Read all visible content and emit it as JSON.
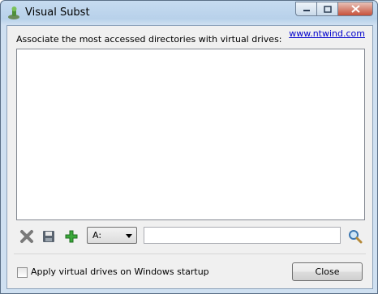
{
  "window": {
    "title": "Visual Subst",
    "app_icon": "visual-subst-app-icon",
    "controls": {
      "minimize_icon": "minimize-icon",
      "maximize_icon": "maximize-icon",
      "close_icon": "close-icon"
    }
  },
  "main": {
    "heading": "Associate the most accessed directories with virtual drives:",
    "website_link": "www.ntwind.com",
    "drives_list": []
  },
  "toolbar": {
    "remove_icon": "remove-icon",
    "save_icon": "save-icon",
    "add_icon": "add-icon",
    "drive_select": {
      "selected": "A:"
    },
    "path_input": {
      "value": "",
      "placeholder": ""
    },
    "browse_icon": "browse-magnifier-icon"
  },
  "footer": {
    "startup_checkbox": {
      "label": "Apply virtual drives on Windows startup",
      "checked": false
    },
    "close_button": "Close"
  },
  "colors": {
    "accent_link": "#0000cc",
    "add_green": "#3aa83a",
    "window_frame": "#c6dbf0"
  }
}
